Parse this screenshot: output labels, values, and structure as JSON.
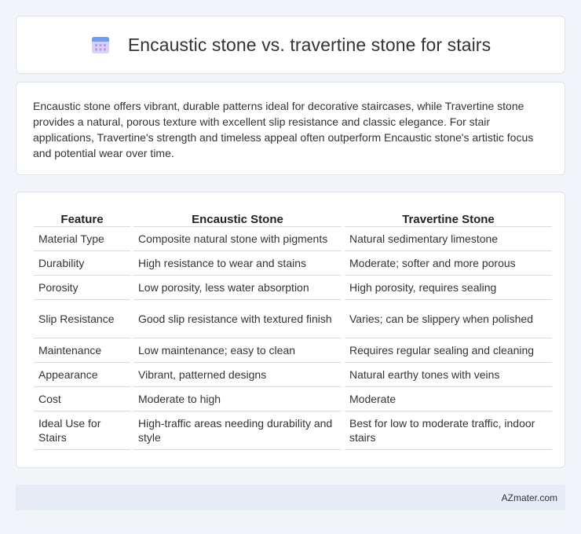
{
  "header": {
    "title": "Encaustic stone vs. travertine stone for stairs",
    "icon": "calendar-icon"
  },
  "summary": {
    "text": "Encaustic stone offers vibrant, durable patterns ideal for decorative staircases, while Travertine stone provides a natural, porous texture with excellent slip resistance and classic elegance. For stair applications, Travertine's strength and timeless appeal often outperform Encaustic stone's artistic focus and potential wear over time."
  },
  "table": {
    "headers": [
      "Feature",
      "Encaustic Stone",
      "Travertine Stone"
    ],
    "rows": [
      [
        "Material Type",
        "Composite natural stone with pigments",
        "Natural sedimentary limestone"
      ],
      [
        "Durability",
        "High resistance to wear and stains",
        "Moderate; softer and more porous"
      ],
      [
        "Porosity",
        "Low porosity, less water absorption",
        "High porosity, requires sealing"
      ],
      [
        "Slip Resistance",
        "Good slip resistance with textured finish",
        "Varies; can be slippery when polished"
      ],
      [
        "Maintenance",
        "Low maintenance; easy to clean",
        "Requires regular sealing and cleaning"
      ],
      [
        "Appearance",
        "Vibrant, patterned designs",
        "Natural earthy tones with veins"
      ],
      [
        "Cost",
        "Moderate to high",
        "Moderate"
      ],
      [
        "Ideal Use for Stairs",
        "High-traffic areas needing durability and style",
        "Best for low to moderate traffic, indoor stairs"
      ]
    ]
  },
  "footer": {
    "text": "AZmater.com"
  },
  "colors": {
    "background": "#f1f4f9",
    "card": "#ffffff",
    "footer": "#e6ecf6",
    "icon_top": "#5b8def",
    "icon_body": "#c9b6f2"
  }
}
